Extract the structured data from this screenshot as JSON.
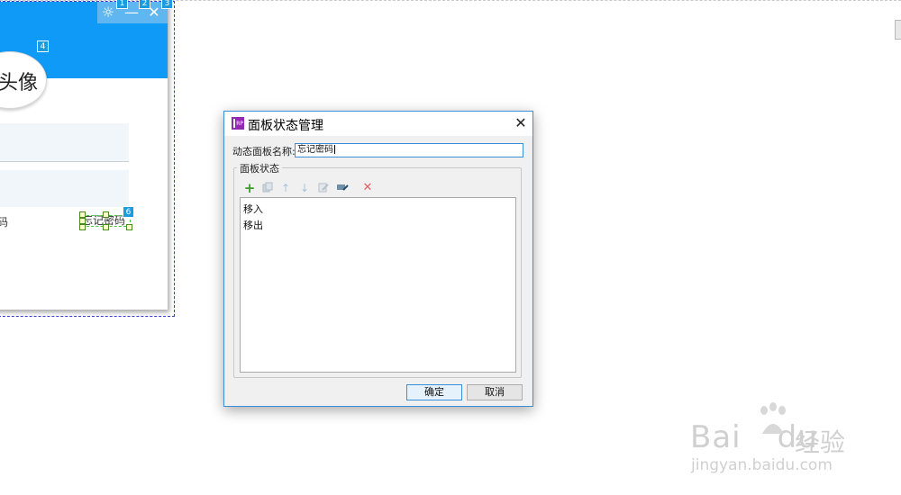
{
  "canvas": {
    "avatar_text": "头像",
    "forget_partial": "码",
    "forget_link": "忘记密码",
    "badges": [
      "1",
      "2",
      "3",
      "4",
      "6"
    ]
  },
  "dialog": {
    "title": "面板状态管理",
    "app_icon_text": "RP",
    "close_icon": "close-icon",
    "name_label": "动态面板名称:",
    "name_value": "忘记密码",
    "group_label": "面板状态",
    "toolbar_icons": [
      "add-icon",
      "duplicate-icon",
      "move-up-icon",
      "move-down-icon",
      "edit-icon",
      "edit-all-icon",
      "delete-icon"
    ],
    "states": [
      "移入",
      "移出"
    ],
    "ok_label": "确定",
    "cancel_label": "取消"
  },
  "watermark": {
    "logo_text": "Bai",
    "logo_text2": "du",
    "cn_text": "经验",
    "url": "jingyan.baidu.com"
  },
  "colors": {
    "header_blue": "#0e9af6",
    "dialog_border": "#3c8ed8",
    "add_green": "#3a9a2a",
    "delete_red": "#e06060"
  }
}
